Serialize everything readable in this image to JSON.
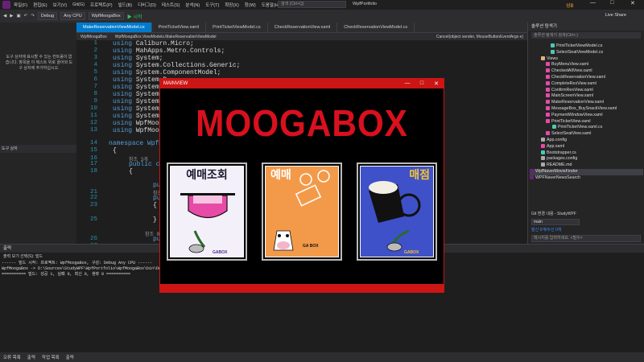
{
  "menubar": {
    "items": [
      "파일(F)",
      "편집(E)",
      "보기(V)",
      "Git(G)",
      "프로젝트(P)",
      "빌드(B)",
      "디버그(D)",
      "테스트(S)",
      "분석(N)",
      "도구(T)",
      "확장(X)",
      "창(W)",
      "도움말(H)"
    ],
    "search_placeholder": "검색 (Ctrl+Q)",
    "solution_name": "WpfPortfolio",
    "user_initial": "성B",
    "minimize": "—",
    "restore": "□",
    "close": "✕"
  },
  "toolbar": {
    "config": "Debug",
    "platform": "Any CPU",
    "startup_project": "WpfMoogaBox",
    "start_label": "▶ 시작",
    "live_share": "Live Share"
  },
  "left_panel": {
    "message": "도구 상자에 표시할 수 있는 컨트롤이 없습니다. 항목을 이 텍스트 위로 끌어와 도구 상자에 추가하십시오.",
    "tab_label": "도구 상자"
  },
  "doc_tabs": [
    "MakeReservationViewModel.cs",
    "PrintTicketView.xaml",
    "PrintTicketViewModel.cs",
    "CheckReservationView.xaml",
    "CheckReservationViewModel.cs"
  ],
  "nav_bar": {
    "project": "WpfMoogaBox",
    "class": "WpfMoogaBox.ViewModels.MakeReservationViewModel",
    "member": "Cancel(object sender, MouseButtonEventArgs e)"
  },
  "editor": {
    "line_numbers": [
      "1",
      "2",
      "3",
      "4",
      "5",
      "6",
      "7",
      "8",
      "9",
      "10",
      "11",
      "12",
      "13",
      "14",
      "15",
      "16",
      "17",
      "18",
      "",
      "21",
      "22",
      "23",
      "",
      "25",
      "",
      "26",
      "27"
    ],
    "using_lines": [
      "Caliburn.Micro;",
      "MahApps.Metro.Controls;",
      "System;",
      "System.Collections.Generic;",
      "System.ComponentModel;",
      "System.D",
      "System.L",
      "System.T",
      "System.W",
      "System.W",
      "System.W",
      "WpfMooga",
      "WpfMooga"
    ],
    "namespace_line": "namespace WpfM",
    "ref_count": "참조 3개",
    "public_cla": "public cla",
    "public_1": "publi",
    "ref_2": "참조 2",
    "public_2": "publi",
    "in_stub": "I",
    "ref_0": "참조 0",
    "public_3": "publi"
  },
  "sol_explorer": {
    "header": "솔루션 탐색기",
    "search": "솔루션 탐색기 검색(Ctrl+;)",
    "items": [
      "PrintTicketViewModel.cs",
      "SelectSeatViewModel.cs",
      "Views",
      "BuyMenuView.xaml",
      "CheckedAllView.xaml",
      "CheckReservationView.xaml",
      "CompleteResView.xaml",
      "ConfirmResView.xaml",
      "MainScreenView.xaml",
      "MakeReservationView.xaml",
      "MessageBox_BuySnackView.xaml",
      "PaymentWindowView.xaml",
      "PrintTicketView.xaml",
      "PrintTicketView.xaml.cs",
      "SelectSeatView.xaml",
      "App.config",
      "App.xaml",
      "Bootstrapper.cs",
      "packages.config",
      "README.md",
      "WpfNaverMovieFinder",
      "WPFNaverNewsSearch"
    ],
    "selected_index": 20
  },
  "git_panel": {
    "header": "Git 변경 내용 - StudyWPF",
    "branch": "main",
    "link": "발신 0개/수신 0개",
    "message_placeholder": "메시지를 입력하세요. <필수>"
  },
  "output": {
    "header": "출력",
    "source_label": "출력 보기 선택(S):  빌드",
    "lines": [
      "------ 빌드 시작: 프로젝트: WpfMoogaBox, 구성: Debug Any CPU ------",
      "WpfMoogaBox -> D:\\Sources\\StudyWPF\\WpfPortfolio\\WpfMoogaBox\\bin\\Debug\\WpfMoogaBox.exe",
      "========== 빌드: 성공 1, 실패 0, 최신 0, 생략 0 =========="
    ]
  },
  "bottom_tabs": [
    "오류 목록",
    "출력",
    "작업 목록",
    "출력"
  ],
  "mainview": {
    "title": "MAINVIEW",
    "logo": "MOOGABOX",
    "cards": [
      {
        "title": "예매조회",
        "sub": "GABOX",
        "bg": "#f4f0fa"
      },
      {
        "title": "예매",
        "sub": "GA BOX",
        "bg": "#f39a4a"
      },
      {
        "title": "매점",
        "sub": "GABOX",
        "bg": "#3f51c8"
      }
    ]
  },
  "colors": {
    "accent": "#007acc",
    "brand_red": "#cc1515",
    "logo_red": "#d9101e"
  }
}
